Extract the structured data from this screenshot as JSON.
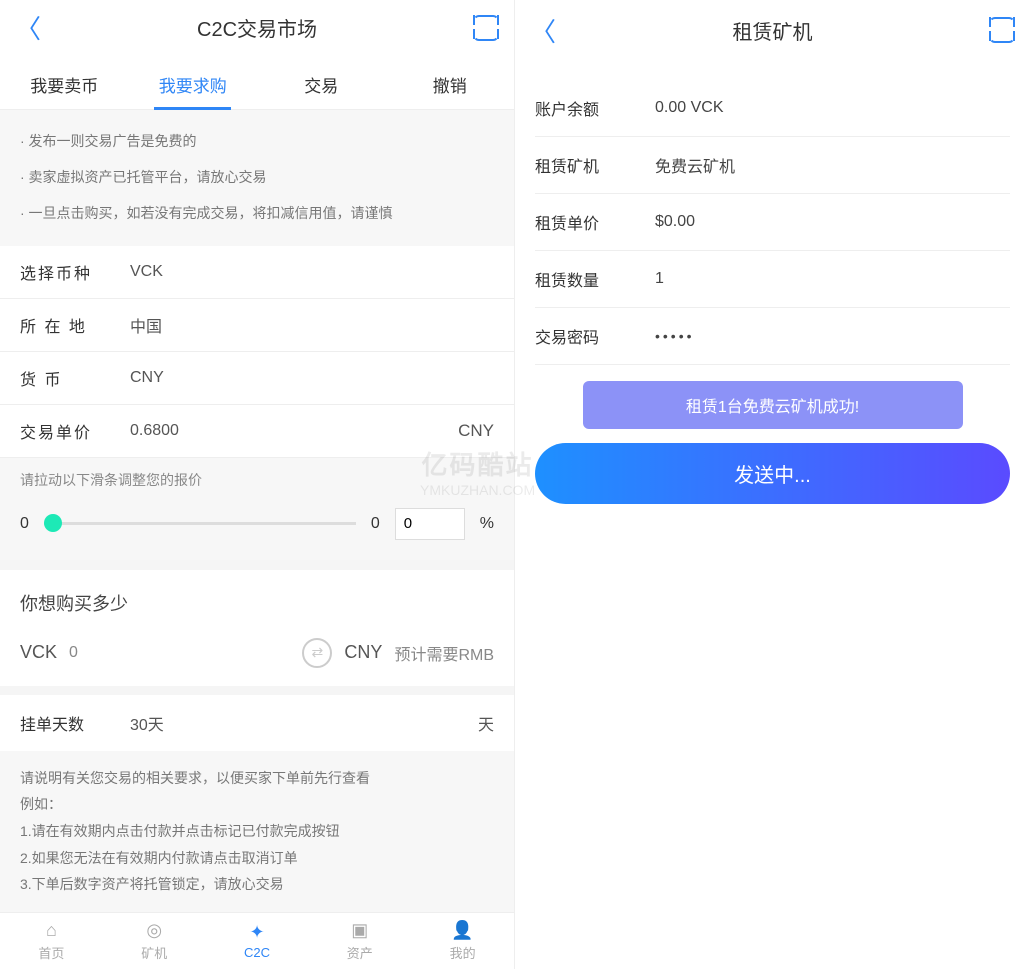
{
  "left": {
    "title": "C2C交易市场",
    "tabs": [
      "我要卖币",
      "我要求购",
      "交易",
      "撤销"
    ],
    "activeTab": 1,
    "notices": [
      "· 发布一则交易广告是免费的",
      "· 卖家虚拟资产已托管平台，请放心交易",
      "· 一旦点击购买，如若没有完成交易，将扣减信用值，请谨慎"
    ],
    "form": {
      "currencyLabel": "选择币种",
      "currencyValue": "VCK",
      "locationLabel": "所 在 地",
      "locationValue": "中国",
      "fiatLabel": "货   币",
      "fiatValue": "CNY",
      "priceLabel": "交易单价",
      "priceValue": "0.6800",
      "priceSuffix": "CNY"
    },
    "sliderHint": "请拉动以下滑条调整您的报价",
    "slider": {
      "min": "0",
      "max": "0",
      "pctValue": "0",
      "pctSuffix": "%"
    },
    "buy": {
      "title": "你想购买多少",
      "vckLabel": "VCK",
      "vckValue": "0",
      "cnyLabel": "CNY",
      "cnyEst": "预计需要RMB"
    },
    "days": {
      "label": "挂单天数",
      "value": "30天",
      "unit": "天"
    },
    "instructions": [
      "请说明有关您交易的相关要求，以便买家下单前先行查看",
      "例如：",
      "1.请在有效期内点击付款并点击标记已付款完成按钮",
      "2.如果您无法在有效期内付款请点击取消订单",
      "3.下单后数字资产将托管锁定，请放心交易"
    ],
    "nav": [
      "首页",
      "矿机",
      "C2C",
      "资产",
      "我的"
    ],
    "navActive": 2
  },
  "right": {
    "title": "租赁矿机",
    "rows": {
      "balanceLabel": "账户余额",
      "balanceValue": "0.00 VCK",
      "machineLabel": "租赁矿机",
      "machineValue": "免费云矿机",
      "priceLabel": "租赁单价",
      "priceValue": "$0.00",
      "qtyLabel": "租赁数量",
      "qtyValue": "1",
      "pwLabel": "交易密码",
      "pwValue": "•••••"
    },
    "toast": "租赁1台免费云矿机成功!",
    "submit": "发送中..."
  },
  "watermark": {
    "brand": "亿码酷站",
    "url": "YMKUZHAN.COM"
  }
}
